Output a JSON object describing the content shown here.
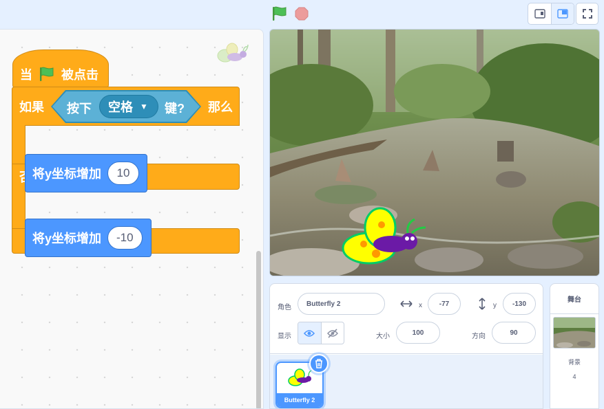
{
  "toolbar": {
    "green_flag_icon": "green-flag-icon",
    "stop_icon": "stop-sign-icon",
    "layout_modes": [
      "small-stage-icon",
      "normal-stage-icon"
    ],
    "fullscreen_icon": "fullscreen-icon",
    "accent_color": "#4c97ff"
  },
  "code": {
    "hat": {
      "prefix": "当",
      "suffix": "被点击",
      "color": "#ffab19"
    },
    "if_else": {
      "if_label": "如果",
      "then_label": "那么",
      "else_label": "否则",
      "condition": {
        "prefix": "按下",
        "key": "空格",
        "suffix": "键?",
        "color": "#5cb1d6"
      }
    },
    "then_block": {
      "label": "将y坐标增加",
      "value": "10",
      "color": "#4c97ff"
    },
    "else_block": {
      "label": "将y坐标增加",
      "value": "-10",
      "color": "#4c97ff"
    }
  },
  "sprite_info": {
    "sprite_label": "角色",
    "sprite_name": "Butterfly 2",
    "x_label": "x",
    "x_value": "-77",
    "y_label": "y",
    "y_value": "-130",
    "show_label": "显示",
    "size_label": "大小",
    "size_value": "100",
    "direction_label": "方向",
    "direction_value": "90"
  },
  "sprites": [
    {
      "name": "Butterfly 2",
      "selected": true
    }
  ],
  "stage_panel": {
    "title": "舞台",
    "backdrops_label": "背景",
    "backdrops_count": "4"
  }
}
